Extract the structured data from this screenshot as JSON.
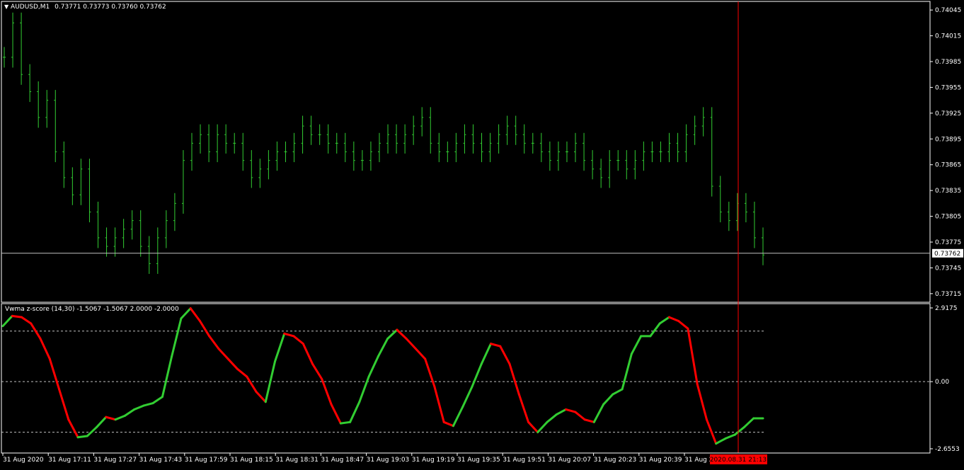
{
  "main_pane": {
    "symbol_label": "AUDUSD,M1",
    "ohlc_values": [
      "0.73771",
      "0.73773",
      "0.73760",
      "0.73762"
    ],
    "price_axis_ticks": [
      "0.74045",
      "0.74015",
      "0.73985",
      "0.73955",
      "0.73925",
      "0.73895",
      "0.73865",
      "0.73835",
      "0.73805",
      "0.73775",
      "0.73745",
      "0.73715"
    ],
    "current_price": "0.73762",
    "bar_color": "#32cd32",
    "bid_line_color": "#c0c0c0"
  },
  "indicator_pane": {
    "title": "Vwma z-score (14,30)",
    "values": [
      "-1.5067",
      "-1.5067",
      "2.0000",
      "-2.0000"
    ],
    "axis_ticks": [
      "2.9175",
      "0.00",
      "-2.6553"
    ],
    "levels": [
      2.0,
      0.0,
      -2.0
    ],
    "up_color": "#32cd32",
    "down_color": "#ff0000"
  },
  "time_axis": {
    "labels": [
      "31 Aug 2020",
      "31 Aug 17:11",
      "31 Aug 17:27",
      "31 Aug 17:43",
      "31 Aug 17:59",
      "31 Aug 18:15",
      "31 Aug 18:31",
      "31 Aug 18:47",
      "31 Aug 19:03",
      "31 Aug 19:19",
      "31 Aug 19:35",
      "31 Aug 19:51",
      "31 Aug 20:07",
      "31 Aug 20:23",
      "31 Aug 20:39",
      "31 Aug 20"
    ],
    "crosshair_label": "2020.08.31 21:13",
    "crosshair_color": "#ff0000"
  },
  "chart_data": [
    {
      "type": "line",
      "title": "AUDUSD,M1",
      "series": [
        {
          "name": "AUDUSD,M1",
          "values": [
            0.7399,
            0.7403,
            0.7397,
            0.7395,
            0.7392,
            0.7394,
            0.7388,
            0.7385,
            0.7383,
            0.7386,
            0.7381,
            0.7378,
            0.7377,
            0.7378,
            0.7379,
            0.738,
            0.7377,
            0.7375,
            0.7378,
            0.738,
            0.7382,
            0.7387,
            0.7389,
            0.739,
            0.7388,
            0.739,
            0.7389,
            0.7389,
            0.7387,
            0.7385,
            0.7386,
            0.7387,
            0.7388,
            0.7388,
            0.7389,
            0.7391,
            0.739,
            0.739,
            0.7389,
            0.7389,
            0.7388,
            0.7387,
            0.7387,
            0.7388,
            0.7389,
            0.739,
            0.7389,
            0.739,
            0.7391,
            0.7392,
            0.7389,
            0.7388,
            0.7388,
            0.7389,
            0.739,
            0.7389,
            0.7388,
            0.7389,
            0.739,
            0.7391,
            0.739,
            0.7389,
            0.7389,
            0.7388,
            0.7387,
            0.7388,
            0.7388,
            0.7389,
            0.7387,
            0.7386,
            0.7385,
            0.7387,
            0.7387,
            0.7386,
            0.7387,
            0.7388,
            0.7388,
            0.7388,
            0.7389,
            0.7388,
            0.739,
            0.7391,
            0.7392,
            0.7384,
            0.7381,
            0.738,
            0.7382,
            0.7381,
            0.7378,
            0.7376
          ]
        }
      ],
      "ylim": [
        0.73705,
        0.74055
      ]
    },
    {
      "type": "line",
      "title": "Vwma z-score (14,30)",
      "series": [
        {
          "name": "Vwma z-score (14,30)",
          "values": [
            2.2,
            2.6,
            2.55,
            2.3,
            1.7,
            0.9,
            -0.3,
            -1.5,
            -2.2,
            -2.15,
            -1.8,
            -1.4,
            -1.5,
            -1.35,
            -1.1,
            -0.95,
            -0.85,
            -0.6,
            1.0,
            2.5,
            2.9,
            2.4,
            1.8,
            1.3,
            0.9,
            0.5,
            0.2,
            -0.4,
            -0.8,
            0.8,
            1.9,
            1.8,
            1.5,
            0.7,
            0.1,
            -0.9,
            -1.65,
            -1.6,
            -0.8,
            0.2,
            1.0,
            1.7,
            2.05,
            1.7,
            1.3,
            0.9,
            -0.2,
            -1.6,
            -1.75,
            -1.0,
            -0.2,
            0.7,
            1.5,
            1.4,
            0.7,
            -0.5,
            -1.6,
            -2.0,
            -1.6,
            -1.3,
            -1.1,
            -1.2,
            -1.5,
            -1.6,
            -0.9,
            -0.5,
            -0.3,
            1.1,
            1.8,
            1.8,
            2.3,
            2.55,
            2.4,
            2.1,
            -0.1,
            -1.5,
            -2.45,
            -2.25,
            -2.1,
            -1.8,
            -1.45,
            -1.45
          ]
        }
      ],
      "ylim": [
        -2.6553,
        2.9175
      ]
    }
  ]
}
